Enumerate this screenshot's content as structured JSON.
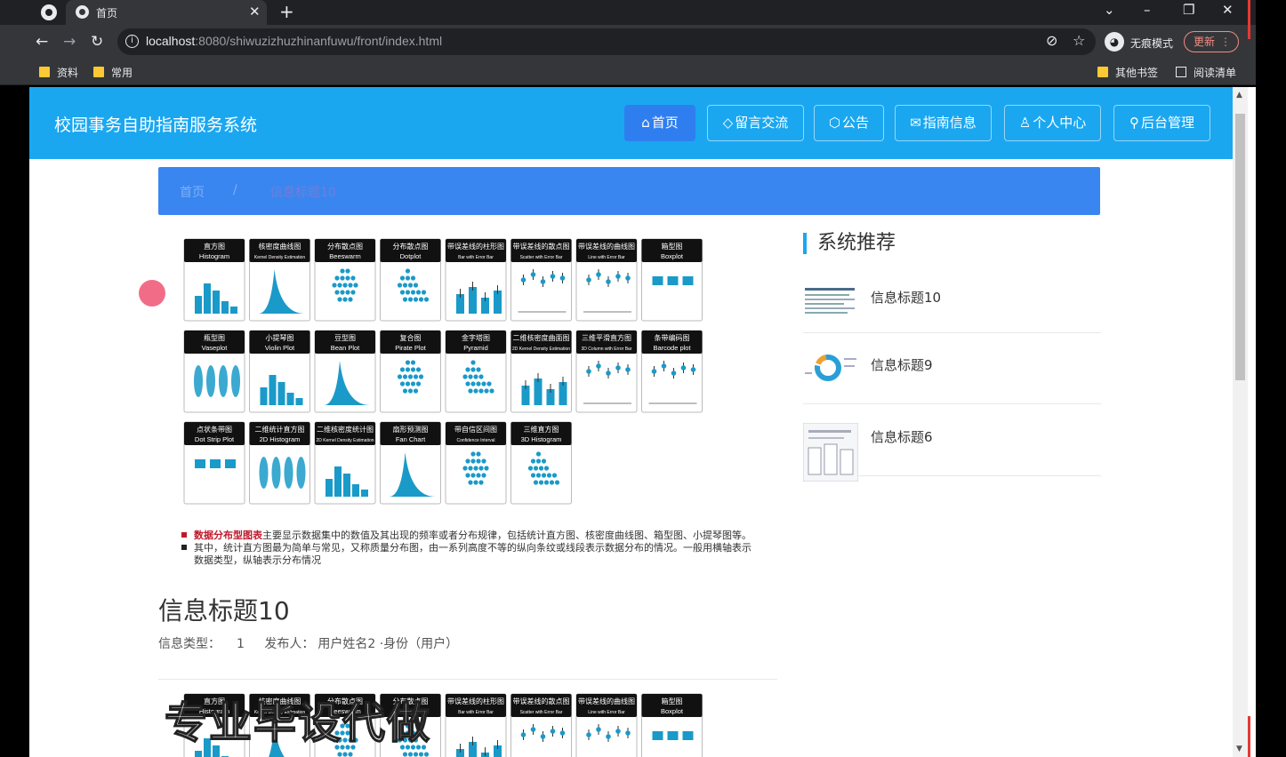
{
  "browser": {
    "tab_title": "首页",
    "url_host": "localhost",
    "url_rest": ":8080/shiwuzizhuzhinanfuwu/front/index.html",
    "incognito_label": "无痕模式",
    "update_label": "更新",
    "bookmarks": [
      "资料",
      "常用"
    ],
    "other_bookmarks": "其他书签",
    "reading_list": "阅读清单"
  },
  "site": {
    "title": "校园事务自助指南服务系统",
    "nav": [
      {
        "label": "首页",
        "icon": "home-icon"
      },
      {
        "label": "留言交流",
        "icon": "tag-icon"
      },
      {
        "label": "公告",
        "icon": "box-icon"
      },
      {
        "label": "指南信息",
        "icon": "mail-icon"
      },
      {
        "label": "个人中心",
        "icon": "user-icon"
      },
      {
        "label": "后台管理",
        "icon": "link-icon"
      }
    ],
    "accent": "#1aa7f0"
  },
  "breadcrumb": {
    "home": "首页",
    "sep": "/",
    "current": "信息标题10"
  },
  "figure": {
    "row1": [
      {
        "cn": "直方图",
        "en": "Histogram"
      },
      {
        "cn": "核密度曲线图",
        "en": "Kernel Density Estimation"
      },
      {
        "cn": "分布散点图",
        "en": "Beeswarm"
      },
      {
        "cn": "分布散点图",
        "en": "Dotplot"
      },
      {
        "cn": "带误差线的柱形图",
        "en": "Bar with Error Bar"
      },
      {
        "cn": "带误差线的散点图",
        "en": "Scatter with Error Bar"
      },
      {
        "cn": "带误差线的曲线图",
        "en": "Line with Error Bar"
      },
      {
        "cn": "箱型图",
        "en": "Boxplot"
      }
    ],
    "row2": [
      {
        "cn": "瓶型图",
        "en": "Vaseplot"
      },
      {
        "cn": "小提琴图",
        "en": "Violin Plot"
      },
      {
        "cn": "豆型图",
        "en": "Bean Plot"
      },
      {
        "cn": "复合图",
        "en": "Pirate Plot"
      },
      {
        "cn": "金字塔图",
        "en": "Pyramid"
      },
      {
        "cn": "二维核密度曲面图",
        "en": "2D Kernel Density Estimation"
      },
      {
        "cn": "三维平滑直方图",
        "en": "3D Column with Error Bar"
      },
      {
        "cn": "条带编码图",
        "en": "Barcode plot"
      }
    ],
    "row3": [
      {
        "cn": "点状条带图",
        "en": "Dot Strip Plot"
      },
      {
        "cn": "二维统计直方图",
        "en": "2D Histogram"
      },
      {
        "cn": "二维核密度统计图",
        "en": "2D Kernel Density Estimation"
      },
      {
        "cn": "扇形预测图",
        "en": "Fan Chart"
      },
      {
        "cn": "带自信区间图",
        "en": "Confidence Interval"
      },
      {
        "cn": "三维直方图",
        "en": "3D Histogram"
      }
    ],
    "caption_bold": "数据分布型图表",
    "caption_line1": "主要显示数据集中的数值及其出现的频率或者分布规律，包括统计直方图、核密度曲线图、箱型图、小提琴图等。",
    "caption_line2": "其中，统计直方图最为简单与常见，又称质量分布图，由一系列高度不等的纵向条纹或线段表示数据分布的情况。一般用横轴表示",
    "caption_line3": "数据类型，纵轴表示分布情况"
  },
  "detail": {
    "title": "信息标题10",
    "type_label": "信息类型：",
    "type_value": "1",
    "publisher_label": "发布人：",
    "publisher_value": "用户姓名2 ·身份（用户）"
  },
  "watermark": "专业毕设代做",
  "recommend": {
    "title": "系统推荐",
    "items": [
      {
        "title": "信息标题10"
      },
      {
        "title": "信息标题9"
      },
      {
        "title": "信息标题6"
      }
    ]
  }
}
